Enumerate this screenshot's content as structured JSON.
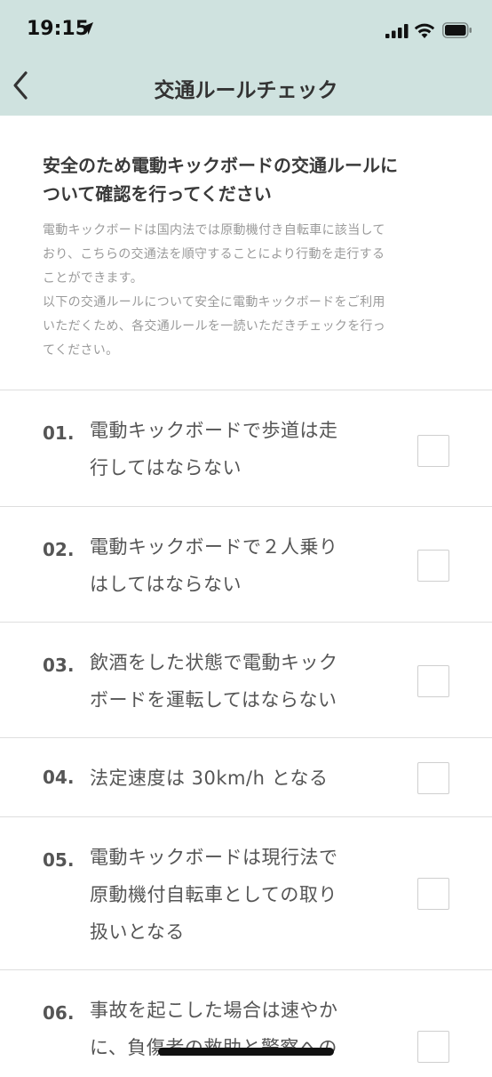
{
  "status_bar": {
    "time": "19:15"
  },
  "nav": {
    "title": "交通ルールチェック"
  },
  "intro": {
    "heading_line1": "安全のため電動キックボードの交通ルールに",
    "heading_line2": "ついて確認を行ってください",
    "body_lines": [
      "電動キックボードは国内法では原動機付き自転車に該当して",
      "おり、こちらの交通法を順守することにより行動を走行する",
      "ことができます。",
      "以下の交通ルールについて安全に電動キックボードをご利用",
      "いただくため、各交通ルールを一読いただきチェックを行っ",
      "てください。"
    ]
  },
  "rules": [
    {
      "num": "01.",
      "lines": [
        "電動キックボードで歩道は走",
        "行してはならない"
      ],
      "checked": false
    },
    {
      "num": "02.",
      "lines": [
        "電動キックボードで２人乗り",
        "はしてはならない"
      ],
      "checked": false
    },
    {
      "num": "03.",
      "lines": [
        "飲酒をした状態で電動キック",
        "ボードを運転してはならない"
      ],
      "checked": false
    },
    {
      "num": "04.",
      "lines": [
        "法定速度は 30km/h となる"
      ],
      "checked": false
    },
    {
      "num": "05.",
      "lines": [
        "電動キックボードは現行法で",
        "原動機付自転車としての取り",
        "扱いとなる"
      ],
      "checked": false
    },
    {
      "num": "06.",
      "lines": [
        "事故を起こした場合は速やか",
        "に、負傷者の救助と警察への"
      ],
      "checked": false
    }
  ],
  "icons": {
    "back": "chevron-left-icon",
    "location": "location-arrow-icon",
    "signal": "cellular-signal-icon",
    "wifi": "wifi-icon",
    "battery": "battery-icon"
  },
  "colors": {
    "header_bg": "#cfe2df",
    "divider": "#dedede"
  }
}
